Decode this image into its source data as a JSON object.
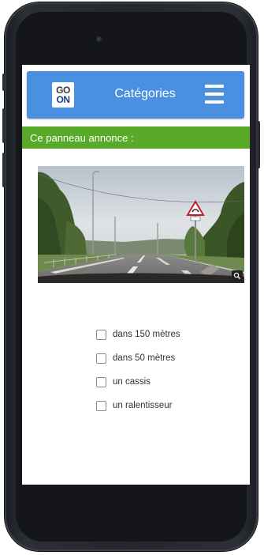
{
  "header": {
    "logo_top": "GO",
    "logo_bottom": "ON",
    "title": "Catégories",
    "menu_icon": "hamburger-menu-icon"
  },
  "quiz": {
    "question": "Ce panneau annonce  :",
    "image_controls": {
      "zoom_icon": "magnifier-icon"
    },
    "answers": [
      {
        "label": "dans 150 mètres",
        "checked": false
      },
      {
        "label": "dans 50 mètres",
        "checked": false
      },
      {
        "label": "un cassis",
        "checked": false
      },
      {
        "label": "un ralentisseur",
        "checked": false
      }
    ]
  },
  "colors": {
    "header_blue": "#4a8fe0",
    "question_green": "#5aaa2a",
    "phone_frame": "#24272c"
  }
}
